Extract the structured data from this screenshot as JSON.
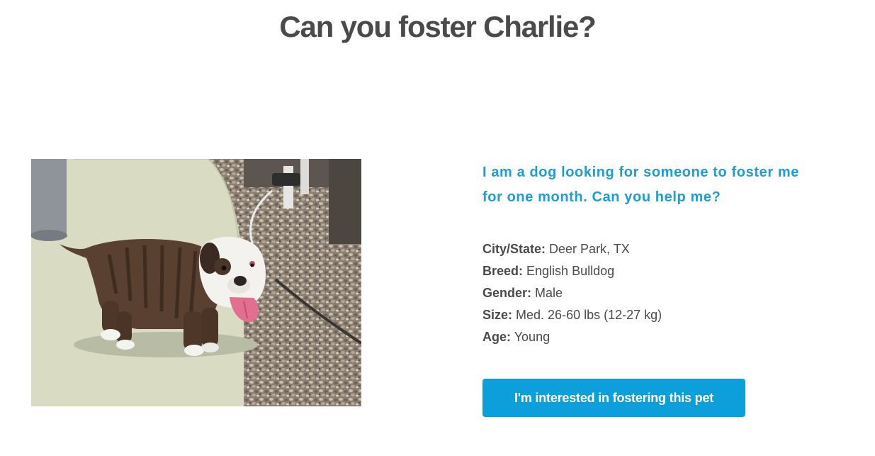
{
  "page": {
    "title": "Can you foster Charlie?"
  },
  "pet": {
    "photo_alt": "Charlie",
    "tagline": "I am a dog looking for someone to foster me for one month. Can you help me?",
    "details": [
      {
        "label": "City/State:",
        "value": "Deer Park, TX"
      },
      {
        "label": "Breed:",
        "value": "English Bulldog"
      },
      {
        "label": "Gender:",
        "value": "Male"
      },
      {
        "label": "Size:",
        "value": "Med. 26-60 lbs (12-27 kg)"
      },
      {
        "label": "Age:",
        "value": "Young"
      }
    ]
  },
  "actions": {
    "foster_label": "I'm interested in fostering this pet"
  },
  "colors": {
    "accent": "#1a9ed8",
    "button": "#0c9fdb",
    "text": "#4a4a4a"
  }
}
